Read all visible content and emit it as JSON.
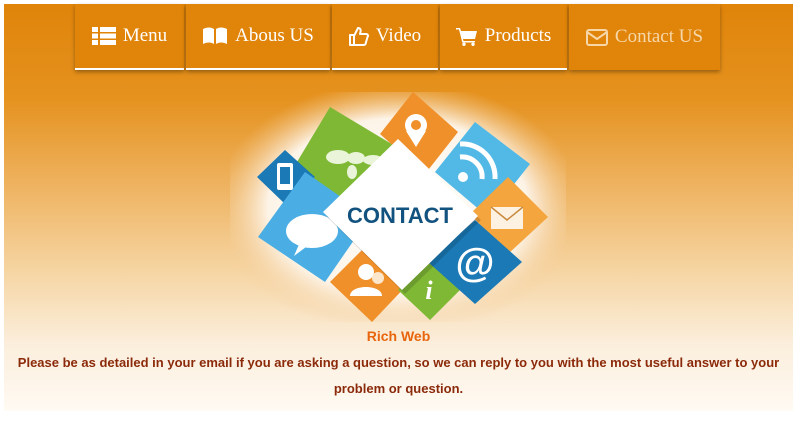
{
  "nav": {
    "items": [
      {
        "label": "Menu",
        "icon": "list-icon"
      },
      {
        "label": "Abous US",
        "icon": "book-icon"
      },
      {
        "label": "Video",
        "icon": "thumbs-up-icon"
      },
      {
        "label": "Products",
        "icon": "shopping-cart-icon"
      },
      {
        "label": "Contact US",
        "icon": "envelope-icon",
        "active": true
      }
    ]
  },
  "banner": {
    "label": "CONTACT"
  },
  "content": {
    "title": "Rich Web",
    "paragraph": "Please be as detailed in your email if you are asking a question, so we can reply to you with the most useful answer to your problem or question."
  },
  "colors": {
    "accent": "#e0840a",
    "title": "#e8650e",
    "text": "#8b2a0a"
  }
}
